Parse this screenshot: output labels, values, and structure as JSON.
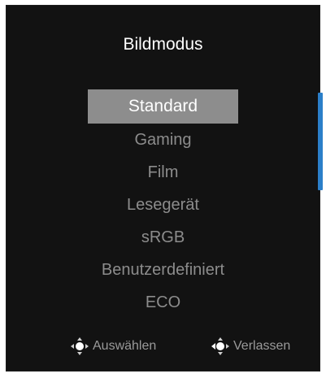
{
  "osd": {
    "title": "Bildmodus",
    "menu": {
      "items": [
        {
          "label": "Standard",
          "selected": true
        },
        {
          "label": "Gaming",
          "selected": false
        },
        {
          "label": "Film",
          "selected": false
        },
        {
          "label": "Lesegerät",
          "selected": false
        },
        {
          "label": "sRGB",
          "selected": false
        },
        {
          "label": "Benutzerdefiniert",
          "selected": false
        },
        {
          "label": "ECO",
          "selected": false
        }
      ]
    },
    "hints": {
      "select": {
        "label": "Auswählen",
        "icon": "joystick-icon"
      },
      "exit": {
        "label": "Verlassen",
        "icon": "joystick-left-icon"
      }
    },
    "colors": {
      "panel_background": "#121212",
      "selected_background": "#8d8d8d",
      "selected_text": "#ffffff",
      "item_text": "#8c8c8c",
      "accent": "#2b7fc9"
    }
  }
}
